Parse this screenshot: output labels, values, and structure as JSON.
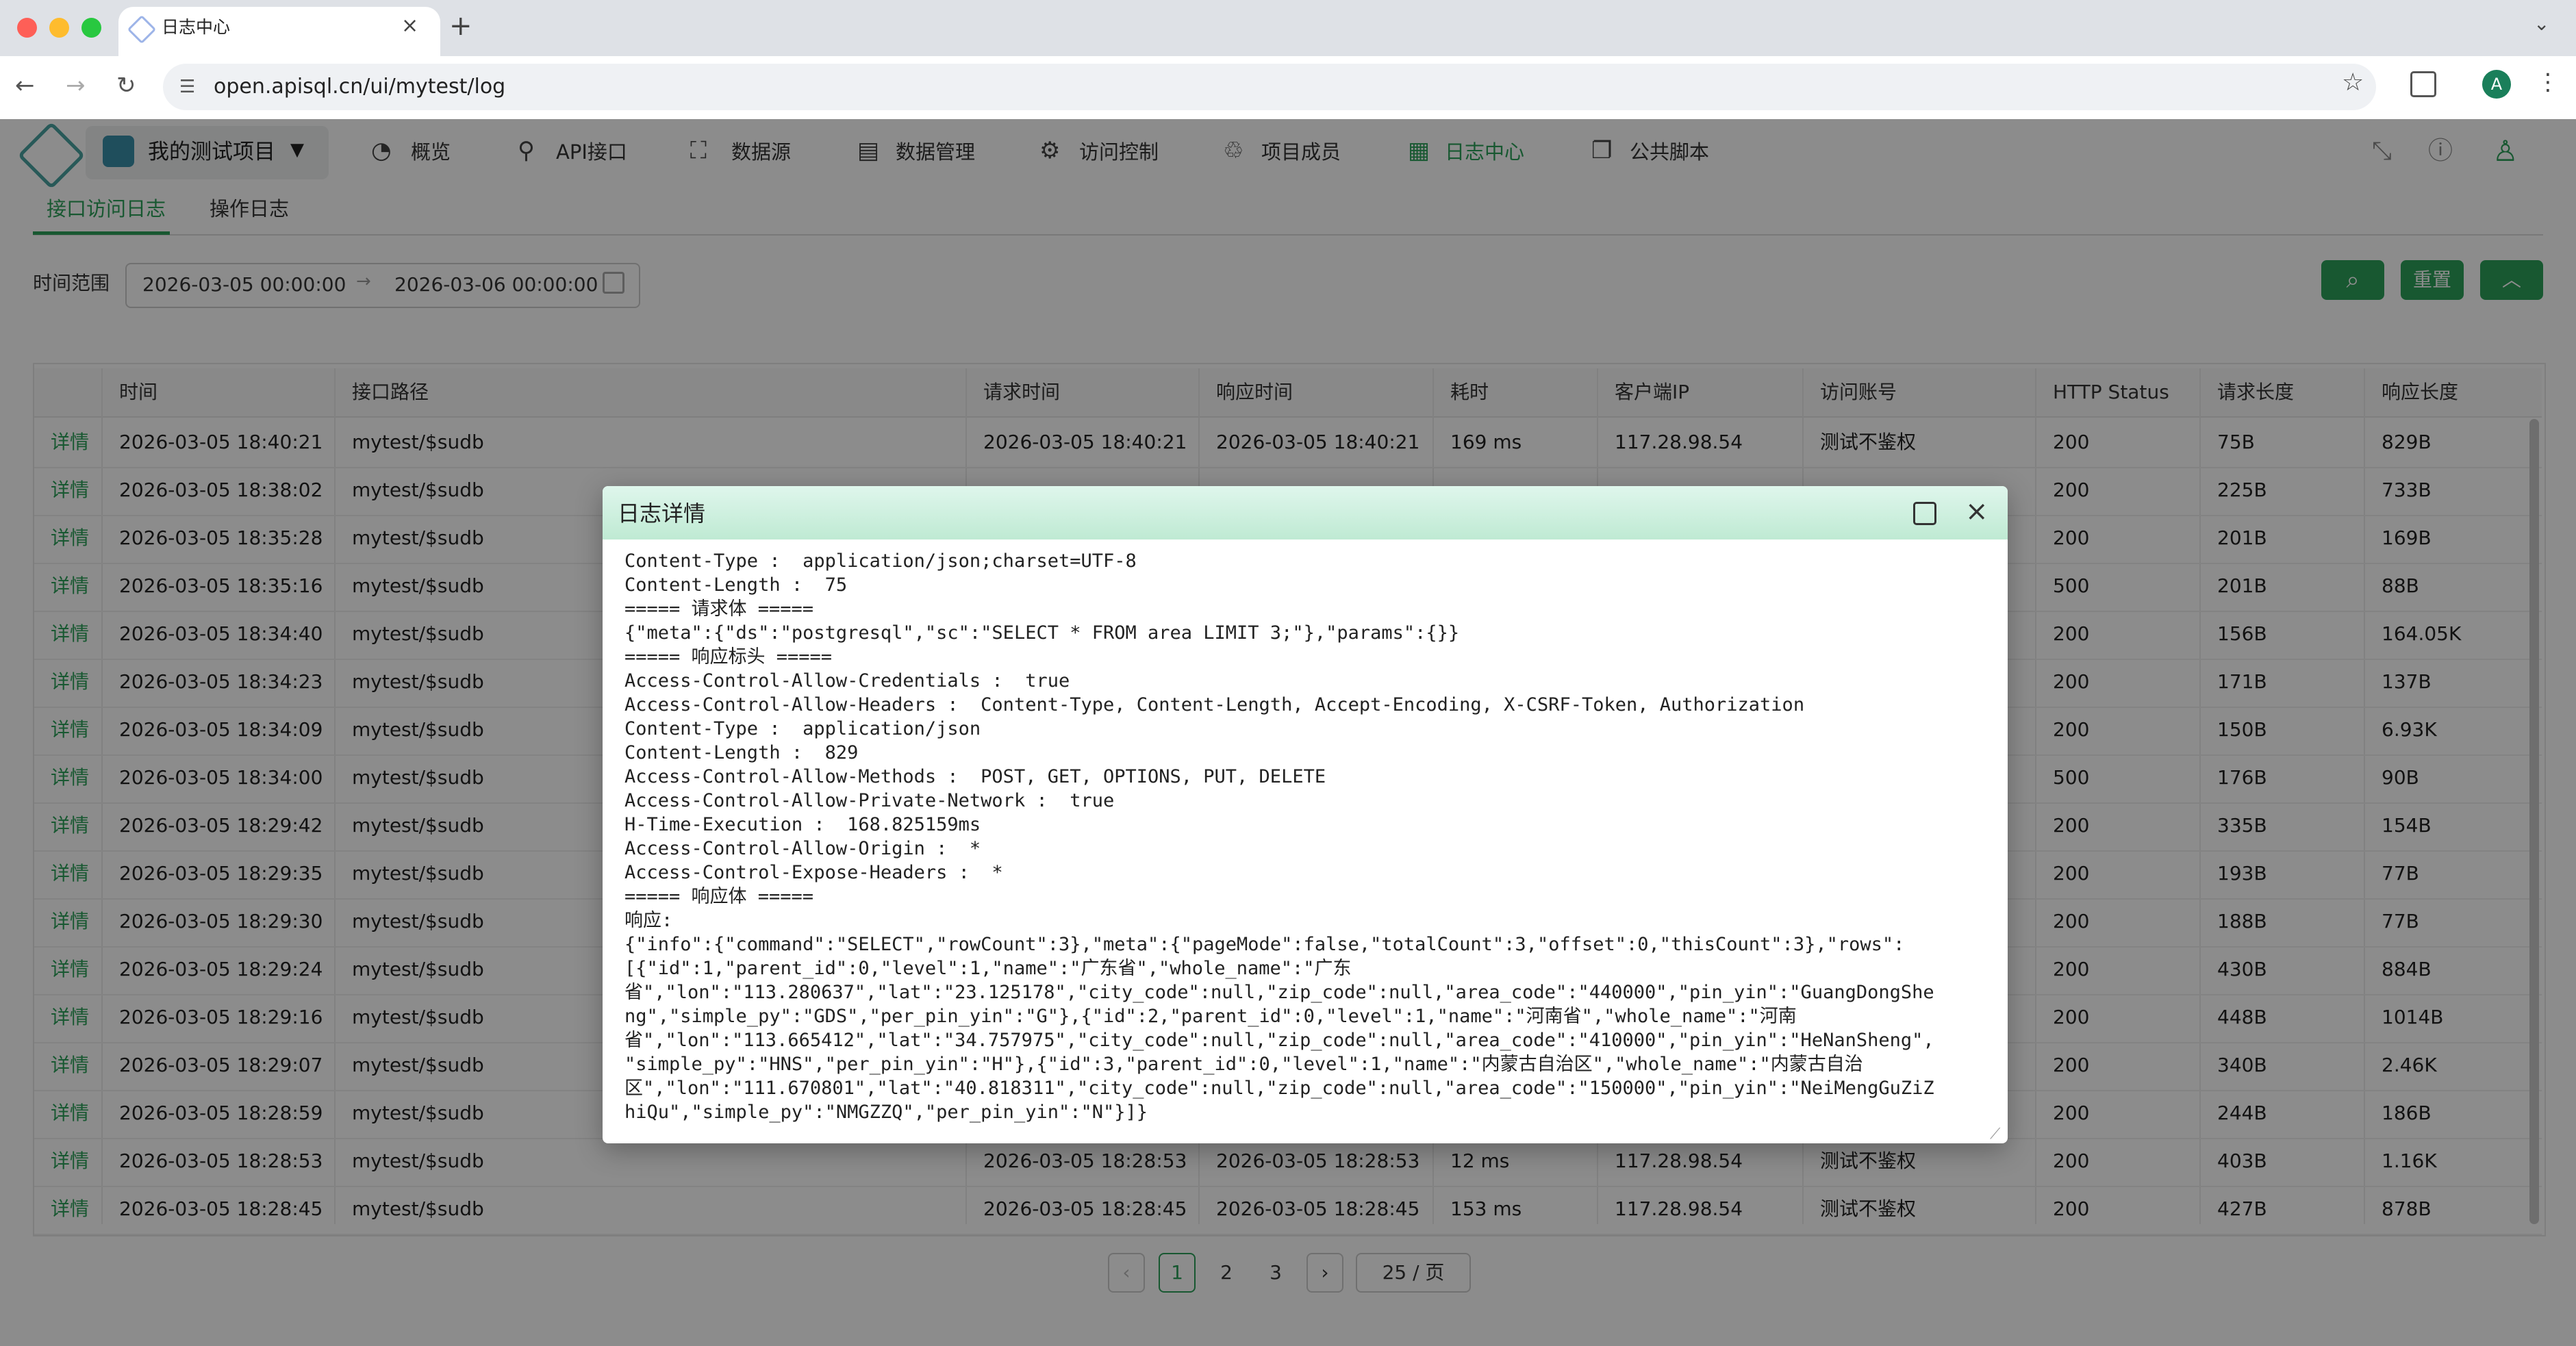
{
  "browser": {
    "tab_title": "日志中心",
    "url": "open.apisql.cn/ui/mytest/log",
    "profile_initial": "A"
  },
  "header": {
    "project": "我的测试项目",
    "nav": [
      {
        "label": "概览",
        "icon": "dashboard-icon"
      },
      {
        "label": "API接口",
        "icon": "api-icon"
      },
      {
        "label": "数据源",
        "icon": "datasource-icon"
      },
      {
        "label": "数据管理",
        "icon": "data-management-icon"
      },
      {
        "label": "访问控制",
        "icon": "gear-icon"
      },
      {
        "label": "项目成员",
        "icon": "members-icon"
      },
      {
        "label": "日志中心",
        "icon": "log-icon",
        "active": true
      },
      {
        "label": "公共脚本",
        "icon": "script-icon"
      }
    ]
  },
  "subtabs": [
    "接口访问日志",
    "操作日志"
  ],
  "filter": {
    "label": "时间范围",
    "start": "2026-03-05 00:00:00",
    "end": "2026-03-06 00:00:00",
    "reset_label": "重置"
  },
  "table": {
    "columns": [
      "时间",
      "接口路径",
      "请求时间",
      "响应时间",
      "耗时",
      "客户端IP",
      "访问账号",
      "HTTP Status",
      "请求长度",
      "响应长度"
    ],
    "detail_label": "详情",
    "rows": [
      {
        "time": "2026-03-05 18:40:21",
        "path": "mytest/$sudb",
        "req_time": "2026-03-05 18:40:21",
        "resp_time": "2026-03-05 18:40:21",
        "cost": "169 ms",
        "ip": "117.28.98.54",
        "account": "测试不鉴权",
        "status": "200",
        "req_len": "75B",
        "resp_len": "829B"
      },
      {
        "time": "2026-03-05 18:38:02",
        "path": "mytest/$sudb",
        "status": "200",
        "req_len": "225B",
        "resp_len": "733B"
      },
      {
        "time": "2026-03-05 18:35:28",
        "path": "mytest/$sudb",
        "status": "200",
        "req_len": "201B",
        "resp_len": "169B"
      },
      {
        "time": "2026-03-05 18:35:16",
        "path": "mytest/$sudb",
        "status": "500",
        "req_len": "201B",
        "resp_len": "88B"
      },
      {
        "time": "2026-03-05 18:34:40",
        "path": "mytest/$sudb",
        "status": "200",
        "req_len": "156B",
        "resp_len": "164.05K"
      },
      {
        "time": "2026-03-05 18:34:23",
        "path": "mytest/$sudb",
        "status": "200",
        "req_len": "171B",
        "resp_len": "137B"
      },
      {
        "time": "2026-03-05 18:34:09",
        "path": "mytest/$sudb",
        "status": "200",
        "req_len": "150B",
        "resp_len": "6.93K"
      },
      {
        "time": "2026-03-05 18:34:00",
        "path": "mytest/$sudb",
        "status": "500",
        "req_len": "176B",
        "resp_len": "90B"
      },
      {
        "time": "2026-03-05 18:29:42",
        "path": "mytest/$sudb",
        "status": "200",
        "req_len": "335B",
        "resp_len": "154B"
      },
      {
        "time": "2026-03-05 18:29:35",
        "path": "mytest/$sudb",
        "status": "200",
        "req_len": "193B",
        "resp_len": "77B"
      },
      {
        "time": "2026-03-05 18:29:30",
        "path": "mytest/$sudb",
        "status": "200",
        "req_len": "188B",
        "resp_len": "77B"
      },
      {
        "time": "2026-03-05 18:29:24",
        "path": "mytest/$sudb",
        "status": "200",
        "req_len": "430B",
        "resp_len": "884B"
      },
      {
        "time": "2026-03-05 18:29:16",
        "path": "mytest/$sudb",
        "status": "200",
        "req_len": "448B",
        "resp_len": "1014B"
      },
      {
        "time": "2026-03-05 18:29:07",
        "path": "mytest/$sudb",
        "status": "200",
        "req_len": "340B",
        "resp_len": "2.46K"
      },
      {
        "time": "2026-03-05 18:28:59",
        "path": "mytest/$sudb",
        "status": "200",
        "req_len": "244B",
        "resp_len": "186B"
      },
      {
        "time": "2026-03-05 18:28:53",
        "path": "mytest/$sudb",
        "req_time": "2026-03-05 18:28:53",
        "resp_time": "2026-03-05 18:28:53",
        "cost": "12 ms",
        "ip": "117.28.98.54",
        "account": "测试不鉴权",
        "status": "200",
        "req_len": "403B",
        "resp_len": "1.16K"
      },
      {
        "time": "2026-03-05 18:28:45",
        "path": "mytest/$sudb",
        "req_time": "2026-03-05 18:28:45",
        "resp_time": "2026-03-05 18:28:45",
        "cost": "153 ms",
        "ip": "117.28.98.54",
        "account": "测试不鉴权",
        "status": "200",
        "req_len": "427B",
        "resp_len": "878B"
      }
    ]
  },
  "pagination": {
    "pages": [
      "1",
      "2",
      "3"
    ],
    "current": "1",
    "page_size": "25 / 页"
  },
  "modal": {
    "title": "日志详情",
    "lines": [
      "Content-Type :  application/json;charset=UTF-8",
      "Content-Length :  75",
      "===== 请求体 =====",
      "{\"meta\":{\"ds\":\"postgresql\",\"sc\":\"SELECT * FROM area LIMIT 3;\"},\"params\":{}}",
      "===== 响应标头 =====",
      "Access-Control-Allow-Credentials :  true",
      "Access-Control-Allow-Headers :  Content-Type, Content-Length, Accept-Encoding, X-CSRF-Token, Authorization",
      "Content-Type :  application/json",
      "Content-Length :  829",
      "Access-Control-Allow-Methods :  POST, GET, OPTIONS, PUT, DELETE",
      "Access-Control-Allow-Private-Network :  true",
      "H-Time-Execution :  168.825159ms",
      "Access-Control-Allow-Origin :  *",
      "Access-Control-Expose-Headers :  *",
      "===== 响应体 =====",
      "响应:",
      "{\"info\":{\"command\":\"SELECT\",\"rowCount\":3},\"meta\":{\"pageMode\":false,\"totalCount\":3,\"offset\":0,\"thisCount\":3},\"rows\":",
      "[{\"id\":1,\"parent_id\":0,\"level\":1,\"name\":\"广东省\",\"whole_name\":\"广东",
      "省\",\"lon\":\"113.280637\",\"lat\":\"23.125178\",\"city_code\":null,\"zip_code\":null,\"area_code\":\"440000\",\"pin_yin\":\"GuangDongShe",
      "ng\",\"simple_py\":\"GDS\",\"per_pin_yin\":\"G\"},{\"id\":2,\"parent_id\":0,\"level\":1,\"name\":\"河南省\",\"whole_name\":\"河南",
      "省\",\"lon\":\"113.665412\",\"lat\":\"34.757975\",\"city_code\":null,\"zip_code\":null,\"area_code\":\"410000\",\"pin_yin\":\"HeNanSheng\",",
      "\"simple_py\":\"HNS\",\"per_pin_yin\":\"H\"},{\"id\":3,\"parent_id\":0,\"level\":1,\"name\":\"内蒙古自治区\",\"whole_name\":\"内蒙古自治",
      "区\",\"lon\":\"111.670801\",\"lat\":\"40.818311\",\"city_code\":null,\"zip_code\":null,\"area_code\":\"150000\",\"pin_yin\":\"NeiMengGuZiZ",
      "hiQu\",\"simple_py\":\"NMGZZQ\",\"per_pin_yin\":\"N\"}]}"
    ]
  },
  "colors": {
    "accent": "#2ca05a",
    "modal_header": "#bfead3",
    "overlay": "rgba(0,0,0,0.45)"
  }
}
